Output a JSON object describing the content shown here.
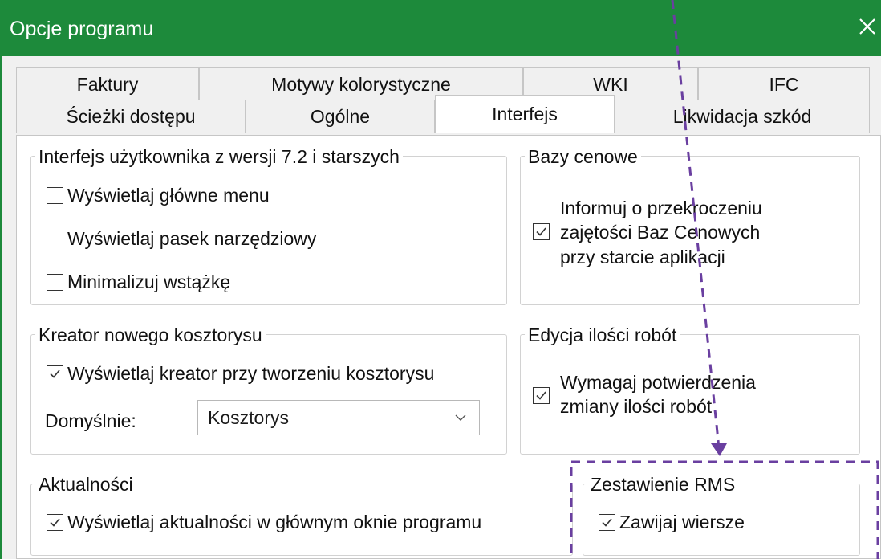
{
  "window": {
    "title": "Opcje programu",
    "close_icon": "close-icon"
  },
  "tabs": {
    "row1": [
      "Faktury",
      "Motywy kolorystyczne",
      "WKI",
      "IFC"
    ],
    "row2": [
      "Ścieżki dostępu",
      "Ogólne",
      "Interfejs",
      "Likwidacja szkód"
    ],
    "active": "Interfejs"
  },
  "groups": {
    "interfejs": {
      "title": "Interfejs użytkownika z wersji 7.2 i starszych",
      "items": [
        {
          "label": "Wyświetlaj główne menu",
          "checked": false
        },
        {
          "label": "Wyświetlaj pasek narzędziowy",
          "checked": false
        },
        {
          "label": "Minimalizuj wstążkę",
          "checked": false
        }
      ]
    },
    "bazy": {
      "title": "Bazy cenowe",
      "lines": [
        "Informuj o przekroczeniu",
        "zajętości Baz Cenowych",
        "przy starcie aplikacji"
      ],
      "checked": true
    },
    "kreator": {
      "title": "Kreator nowego kosztorysu",
      "checkbox_label": "Wyświetlaj kreator przy tworzeniu kosztorysu",
      "checked": true,
      "default_label": "Domyślnie:",
      "select_value": "Kosztorys"
    },
    "edycja": {
      "title": "Edycja ilości robót",
      "lines": [
        "Wymagaj potwierdzenia",
        "zmiany ilości robót"
      ],
      "checked": true
    },
    "aktualnosci": {
      "title": "Aktualności",
      "checkbox_label": "Wyświetlaj aktualności w głównym oknie programu",
      "checked": true
    },
    "rms": {
      "title": "Zestawienie RMS",
      "checkbox_label": "Zawijaj wiersze",
      "checked": true
    }
  },
  "colors": {
    "title_bar": "#1d8a3b",
    "annotation": "#6a3fa0"
  }
}
